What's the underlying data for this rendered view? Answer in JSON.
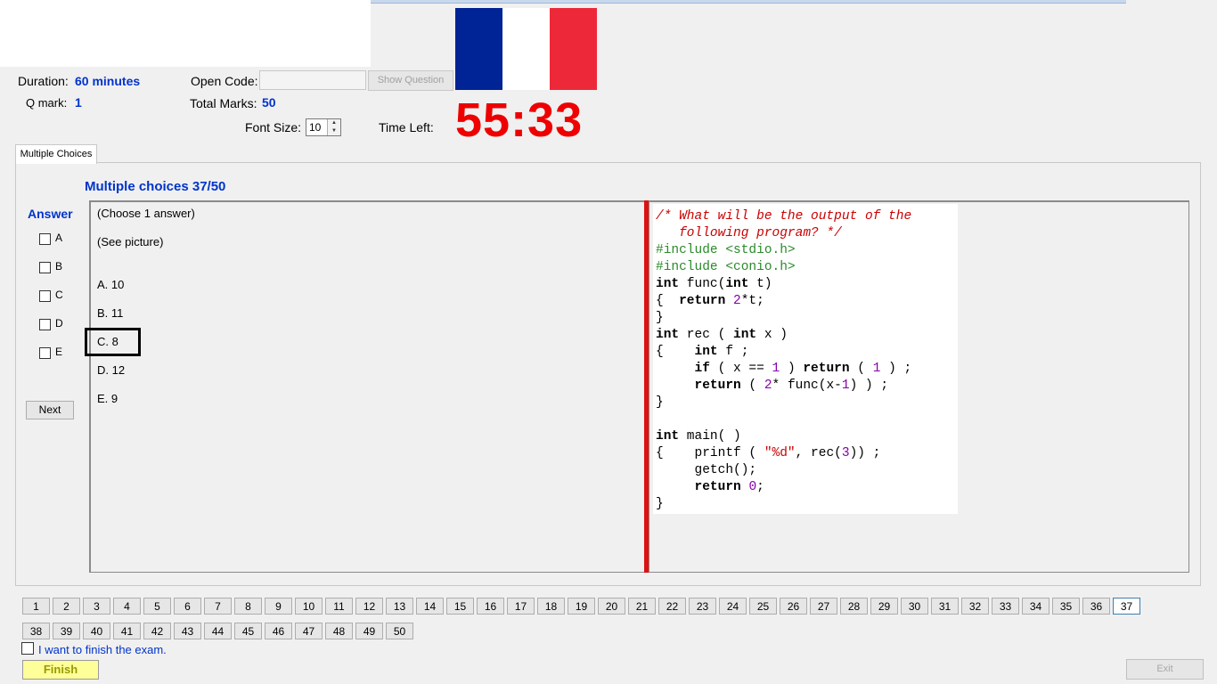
{
  "header": {
    "duration_label": "Duration:",
    "duration_value": "60 minutes",
    "qmark_label": "Q mark:",
    "qmark_value": "1",
    "open_code_label": "Open Code:",
    "open_code_value": "",
    "show_question_label": "Show Question",
    "total_marks_label": "Total Marks:",
    "total_marks_value": "50",
    "font_size_label": "Font Size:",
    "font_size_value": "10",
    "time_left_label": "Time Left:",
    "time_left_value": "55:33"
  },
  "flag": {
    "colors": [
      "#002395",
      "#ffffff",
      "#ed2939"
    ]
  },
  "tab": {
    "label": "Multiple Choices"
  },
  "question": {
    "title": "Multiple choices 37/50",
    "instruction": "(Choose 1 answer)",
    "see_picture": "(See picture)",
    "options": [
      {
        "text": "A. 10"
      },
      {
        "text": "B. 11"
      },
      {
        "text": "C. 8"
      },
      {
        "text": "D. 12"
      },
      {
        "text": "E. 9"
      }
    ]
  },
  "answer": {
    "title": "Answer",
    "choices": [
      "A",
      "B",
      "C",
      "D",
      "E"
    ],
    "next_label": "Next"
  },
  "code": {
    "comment_line1": "/* What will be the output of the",
    "comment_line2": "   following program? */",
    "include1": "#include <stdio.h>",
    "include2": "#include <conio.h>"
  },
  "navigation": {
    "current": "37",
    "row1": [
      "1",
      "2",
      "3",
      "4",
      "5",
      "6",
      "7",
      "8",
      "9",
      "10",
      "11",
      "12",
      "13",
      "14",
      "15",
      "16",
      "17",
      "18",
      "19",
      "20",
      "21",
      "22",
      "23",
      "24",
      "25",
      "26",
      "27",
      "28",
      "29",
      "30",
      "31",
      "32",
      "33",
      "34",
      "35",
      "36",
      "37"
    ],
    "row2": [
      "38",
      "39",
      "40",
      "41",
      "42",
      "43",
      "44",
      "45",
      "46",
      "47",
      "48",
      "49",
      "50"
    ]
  },
  "footer": {
    "finish_checkbox_label": "I want to finish the exam.",
    "finish_label": "Finish",
    "exit_label": "Exit"
  },
  "colors": {
    "accent_blue": "#0033cc",
    "timer_red": "#ee0000",
    "divider_red": "#dd1111",
    "finish_yellow": "#ffff99"
  }
}
